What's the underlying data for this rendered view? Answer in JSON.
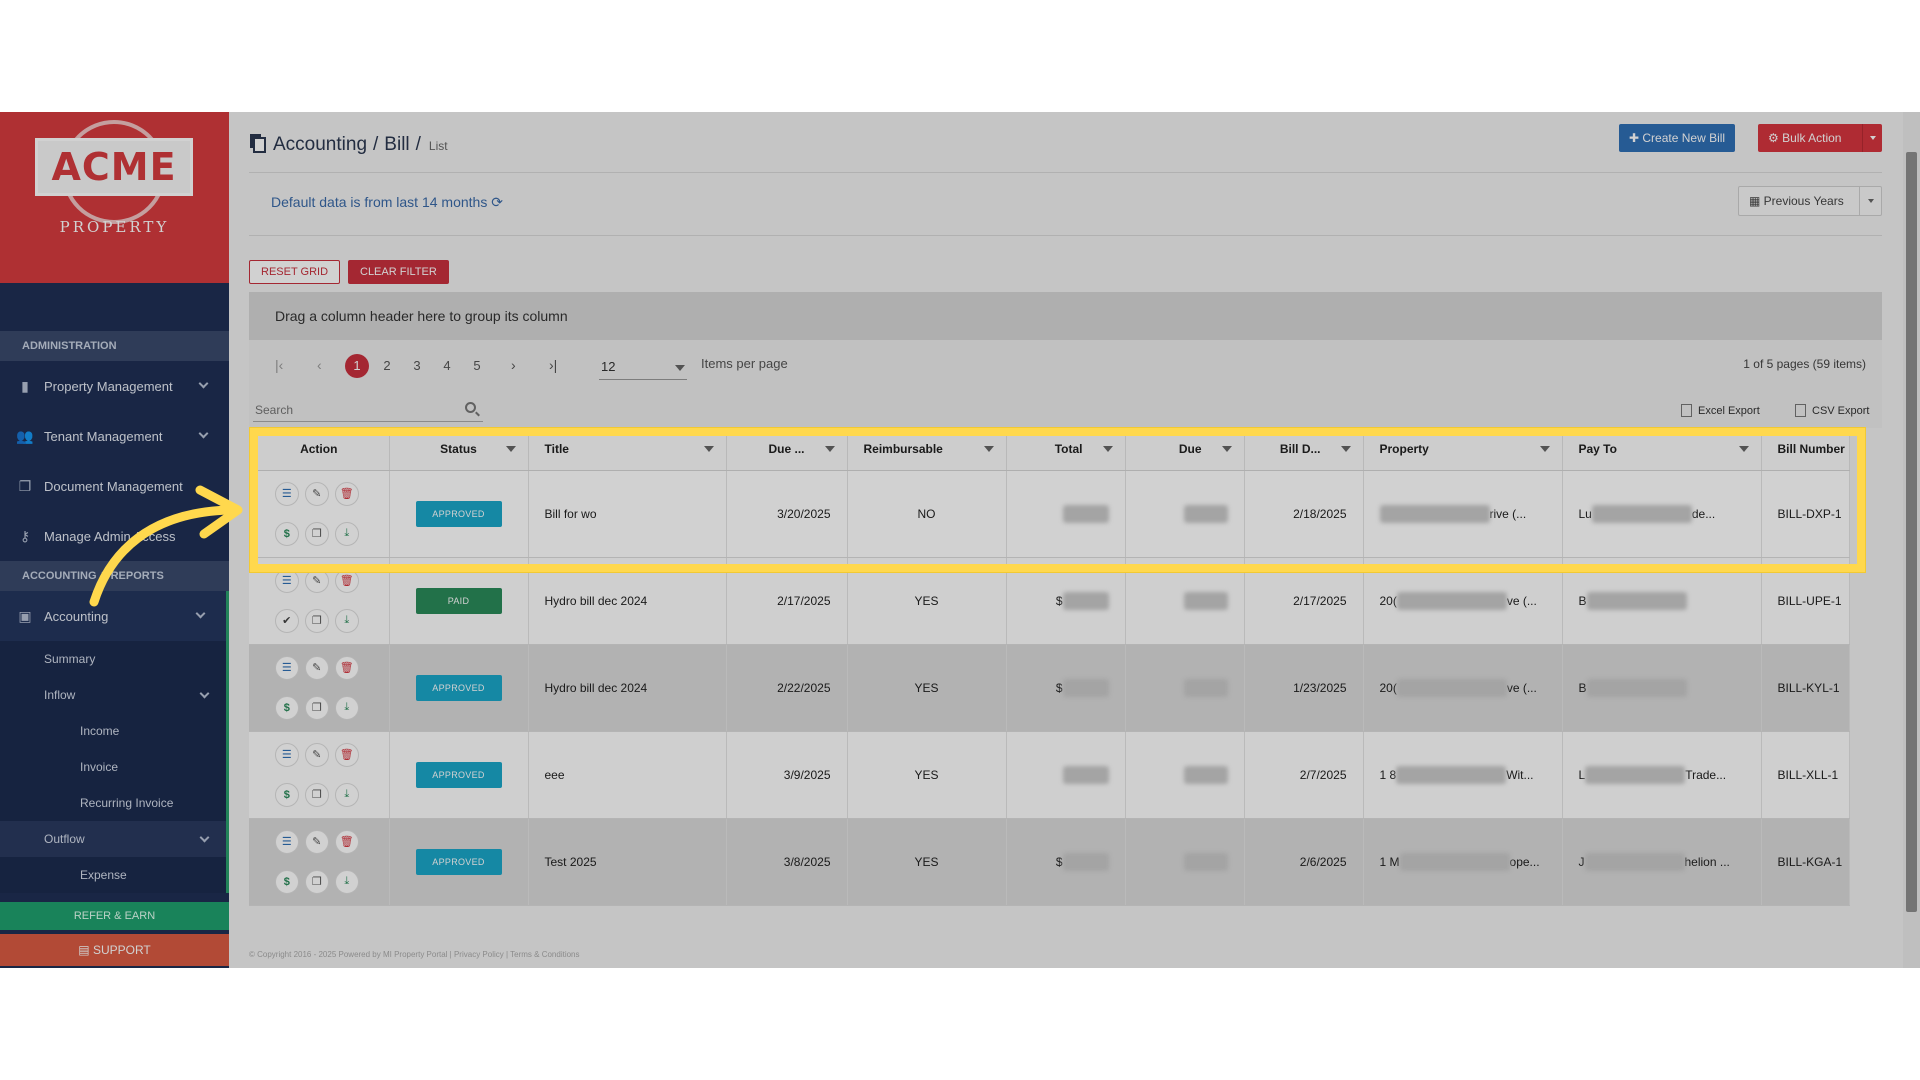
{
  "sidebar": {
    "logo_text": "ACME",
    "logo_sub": "PROPERTY",
    "section_admin": "ADMINISTRATION",
    "items": [
      {
        "label": "Property Management"
      },
      {
        "label": "Tenant Management"
      },
      {
        "label": "Document Management"
      },
      {
        "label": "Manage Admin Access"
      }
    ],
    "section_accounting": "ACCOUNTING & REPORTS",
    "accounting_label": "Accounting",
    "sub": {
      "summary": "Summary",
      "inflow": "Inflow",
      "income": "Income",
      "invoice": "Invoice",
      "recurring": "Recurring Invoice",
      "outflow": "Outflow",
      "expense": "Expense"
    },
    "refer": "REFER & EARN",
    "support": "SUPPORT"
  },
  "header": {
    "crumb1": "Accounting",
    "crumb2": "Bill",
    "crumb3": "List",
    "create_btn": "Create New Bill",
    "bulk_btn": "Bulk Action",
    "default_note": "Default data is from last 14 months",
    "prev_years": "Previous Years",
    "reset_grid": "RESET GRID",
    "clear_filter": "CLEAR FILTER"
  },
  "grid": {
    "group_hint": "Drag a column header here to group its column",
    "pages": [
      "1",
      "2",
      "3",
      "4",
      "5"
    ],
    "items_per_page_value": "12",
    "items_per_page_label": "Items per page",
    "page_info": "1 of 5 pages (59 items)",
    "search_placeholder": "Search",
    "excel_export": "Excel Export",
    "csv_export": "CSV Export",
    "columns": [
      "Action",
      "Status",
      "Title",
      "Due ...",
      "Reimbursable",
      "Total",
      "Due",
      "Bill D...",
      "Property",
      "Pay To",
      "Bill Number"
    ],
    "rows": [
      {
        "status": "APPROVED",
        "title": "Bill for wo",
        "due_date": "3/20/2025",
        "reimb": "NO",
        "total_prefix": "",
        "bill_date": "2/18/2025",
        "prop_prefix": "",
        "prop_suffix": "rive (...",
        "payto_prefix": "Lu",
        "payto_suffix": "de...",
        "bill_no": "BILL-DXP-1"
      },
      {
        "status": "PAID",
        "title": "Hydro bill dec 2024",
        "due_date": "2/17/2025",
        "reimb": "YES",
        "total_prefix": "$",
        "bill_date": "2/17/2025",
        "prop_prefix": "20(",
        "prop_suffix": "ve (...",
        "payto_prefix": "B",
        "payto_suffix": "",
        "bill_no": "BILL-UPE-1"
      },
      {
        "status": "APPROVED",
        "title": "Hydro bill dec 2024",
        "due_date": "2/22/2025",
        "reimb": "YES",
        "total_prefix": "$",
        "bill_date": "1/23/2025",
        "prop_prefix": "20(",
        "prop_suffix": "ve (...",
        "payto_prefix": "B",
        "payto_suffix": "",
        "bill_no": "BILL-KYL-1"
      },
      {
        "status": "APPROVED",
        "title": "eee",
        "due_date": "3/9/2025",
        "reimb": "YES",
        "total_prefix": "",
        "bill_date": "2/7/2025",
        "prop_prefix": "1 8",
        "prop_suffix": "Wit...",
        "payto_prefix": "L",
        "payto_suffix": "Trade...",
        "bill_no": "BILL-XLL-1"
      },
      {
        "status": "APPROVED",
        "title": "Test 2025",
        "due_date": "3/8/2025",
        "reimb": "YES",
        "total_prefix": "$",
        "bill_date": "2/6/2025",
        "prop_prefix": "1 M",
        "prop_suffix": "ope...",
        "payto_prefix": "J",
        "payto_suffix": "helion ...",
        "bill_no": "BILL-KGA-1"
      }
    ]
  },
  "footer": "© Copyright 2016 - 2025 Powered by MI Property Portal | Privacy Policy | Terms & Conditions",
  "colors": {
    "highlight": "#ffd84d",
    "brand_red": "#d63b3f",
    "sidebar": "#1f2f55",
    "approved": "#1aa6c8",
    "paid": "#2a8a5a"
  }
}
